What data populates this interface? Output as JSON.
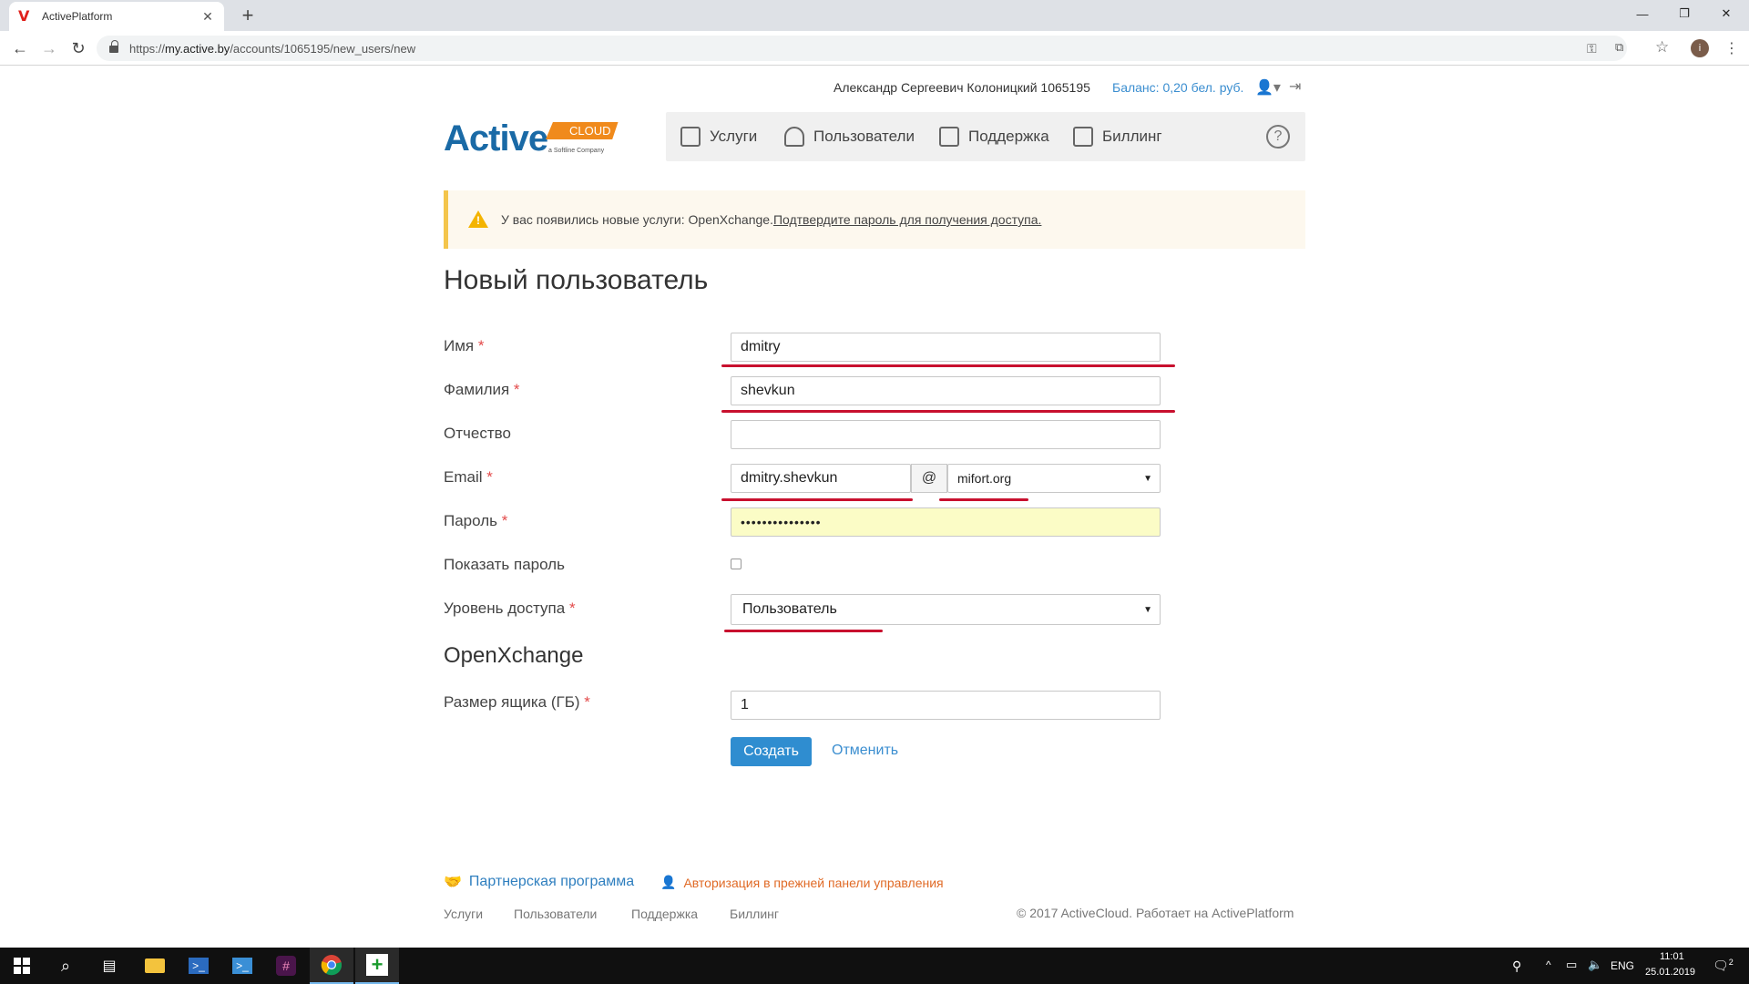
{
  "browser": {
    "tab_title": "ActivePlatform",
    "tab_favicon": "V",
    "url_prefix": "https://",
    "url_host": "my.active.by",
    "url_path": "/accounts/1065195/new_users/new"
  },
  "header": {
    "user": "Александр Сергеевич Колоницкий 1065195",
    "balance": "Баланс: 0,20 бел. руб."
  },
  "logo": {
    "main": "Active",
    "badge": "CLOUD",
    "sub": "a Softline Company"
  },
  "nav": {
    "items": [
      {
        "label": "Услуги",
        "icon": "services-icon"
      },
      {
        "label": "Пользователи",
        "icon": "users-icon"
      },
      {
        "label": "Поддержка",
        "icon": "support-icon"
      },
      {
        "label": "Биллинг",
        "icon": "billing-icon"
      }
    ],
    "help": "?"
  },
  "alert": {
    "text": "У вас появились новые услуги: OpenXchange.",
    "link": "Подтвердите пароль для получения доступа."
  },
  "form": {
    "title": "Новый пользователь",
    "first_name": {
      "label": "Имя",
      "value": "dmitry"
    },
    "last_name": {
      "label": "Фамилия",
      "value": "shevkun"
    },
    "middle_name": {
      "label": "Отчество",
      "value": ""
    },
    "email": {
      "label": "Email",
      "local": "dmitry.shevkun",
      "at": "@",
      "domain": "mifort.org"
    },
    "password": {
      "label": "Пароль",
      "value": "•••••••••••••••"
    },
    "show_password": {
      "label": "Показать пароль",
      "checked": false
    },
    "access_level": {
      "label": "Уровень доступа",
      "value": "Пользователь"
    },
    "section_title": "OpenXchange",
    "mailbox_size": {
      "label": "Размер ящика (ГБ)",
      "value": "1"
    },
    "required_mark": "*",
    "create": "Создать",
    "cancel": "Отменить"
  },
  "footer": {
    "partner": "Партнерская программа",
    "old_panel": "Авторизация в прежней панели управления",
    "links": [
      "Услуги",
      "Пользователи",
      "Поддержка",
      "Биллинг"
    ],
    "copyright": "© 2017 ActiveCloud. Работает на ActivePlatform"
  },
  "taskbar": {
    "lang": "ENG",
    "time": "11:01",
    "date": "25.01.2019",
    "notifications": "2"
  },
  "colors": {
    "accent": "#2f8dd0",
    "underline_annotation": "#c8102e",
    "alert_bar": "#f4c54b",
    "orange": "#e06a26"
  }
}
